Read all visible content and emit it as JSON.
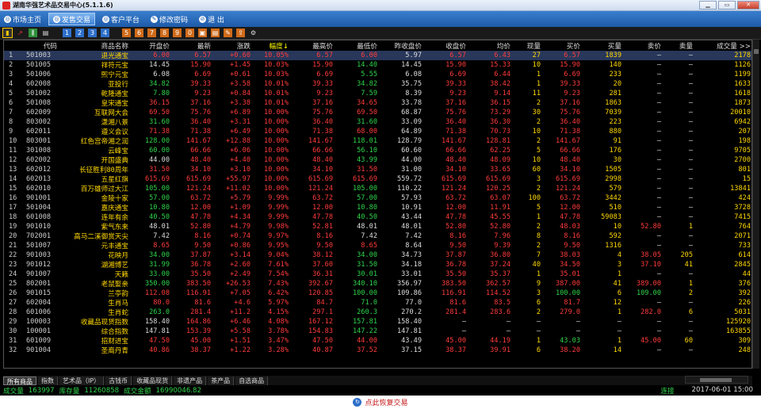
{
  "window": {
    "title": "湖南华强艺术品交易中心(5.1.1.6)"
  },
  "menu": [
    {
      "label": "市场主页",
      "icon": "globe-icon",
      "active": false
    },
    {
      "label": "发售交易",
      "icon": "globe-icon",
      "active": true
    },
    {
      "label": "客户平台",
      "icon": "globe-icon",
      "active": false
    },
    {
      "label": "修改密码",
      "icon": "lock-icon",
      "active": false
    },
    {
      "label": "退   出",
      "icon": "exit-icon",
      "active": false
    }
  ],
  "toolbar_icons": [
    "bar-chart-icon",
    "line-chart-icon",
    "candle-icon",
    "calculator-icon",
    "f1-icon",
    "f2-icon",
    "f3-icon",
    "f4-icon",
    "f5-icon",
    "f6-icon",
    "f7-icon",
    "f8-icon",
    "f9-icon",
    "f10-icon",
    "f11-icon",
    "f12-icon",
    "edit-icon",
    "export-icon",
    "settings-icon"
  ],
  "table": {
    "headers": [
      "",
      "代码",
      "商品名称",
      "开盘价",
      "最新",
      "涨跌",
      "幅度↓",
      "最高价",
      "最低价",
      "昨收盘价",
      "收盘价",
      "均价",
      "现量",
      "买价",
      "买量",
      "卖价",
      "卖量",
      "成交量 >>"
    ],
    "rows": [
      [
        "1",
        "501003",
        "退光通宝",
        "6.00",
        "6.57",
        "+0.60",
        "10.05%",
        "6.57",
        "6.00",
        "5.97",
        "6.57",
        "6.43",
        "27",
        "6.57",
        "1839",
        "—",
        "—",
        "2178"
      ],
      [
        "2",
        "501005",
        "祥符元宝",
        "14.45",
        "15.90",
        "+1.45",
        "10.03%",
        "15.90",
        "14.40",
        "14.45",
        "15.90",
        "15.33",
        "10",
        "15.90",
        "140",
        "—",
        "—",
        "1126"
      ],
      [
        "3",
        "501006",
        "熙宁元宝",
        "6.08",
        "6.69",
        "+0.61",
        "10.03%",
        "6.69",
        "5.55",
        "6.08",
        "6.69",
        "6.44",
        "1",
        "6.69",
        "233",
        "—",
        "—",
        "1199"
      ],
      [
        "4",
        "602008",
        "亚投行",
        "34.82",
        "39.33",
        "+3.58",
        "10.01%",
        "39.33",
        "34.82",
        "35.75",
        "39.33",
        "38.42",
        "1",
        "39.33",
        "20",
        "—",
        "—",
        "1633"
      ],
      [
        "5",
        "501002",
        "乾隆通宝",
        "7.80",
        "9.23",
        "+0.84",
        "10.01%",
        "9.23",
        "7.59",
        "8.39",
        "9.23",
        "9.14",
        "11",
        "9.23",
        "281",
        "—",
        "—",
        "1618"
      ],
      [
        "6",
        "501008",
        "皇宋通宝",
        "36.15",
        "37.16",
        "+3.38",
        "10.01%",
        "37.16",
        "34.65",
        "33.78",
        "37.16",
        "36.15",
        "2",
        "37.16",
        "1863",
        "—",
        "—",
        "1873"
      ],
      [
        "7",
        "602009",
        "互联网大会",
        "69.50",
        "75.76",
        "+6.89",
        "10.00%",
        "75.76",
        "69.50",
        "68.87",
        "75.76",
        "73.29",
        "30",
        "75.76",
        "7039",
        "—",
        "—",
        "20010"
      ],
      [
        "8",
        "803002",
        "潇湘八景",
        "31.60",
        "36.40",
        "+3.31",
        "10.00%",
        "36.40",
        "31.60",
        "33.09",
        "36.40",
        "36.30",
        "2",
        "36.40",
        "223",
        "—",
        "—",
        "6942"
      ],
      [
        "9",
        "602011",
        "遵义会议",
        "71.38",
        "71.38",
        "+6.49",
        "10.00%",
        "71.38",
        "68.00",
        "64.89",
        "71.38",
        "70.73",
        "10",
        "71.38",
        "880",
        "—",
        "—",
        "207"
      ],
      [
        "10",
        "803001",
        "红色宫帝湘之润",
        "128.00",
        "141.67",
        "+12.88",
        "10.00%",
        "141.67",
        "118.01",
        "128.79",
        "141.67",
        "128.81",
        "2",
        "141.67",
        "91",
        "—",
        "—",
        "198"
      ],
      [
        "11",
        "301008",
        "云峰宝",
        "60.00",
        "66.66",
        "+6.06",
        "10.00%",
        "66.66",
        "56.10",
        "60.60",
        "66.66",
        "62.25",
        "5",
        "66.66",
        "176",
        "—",
        "—",
        "9705"
      ],
      [
        "12",
        "602002",
        "开国盛典",
        "44.00",
        "48.40",
        "+4.40",
        "10.00%",
        "48.40",
        "43.99",
        "44.00",
        "48.40",
        "48.09",
        "10",
        "48.40",
        "30",
        "—",
        "—",
        "2700"
      ],
      [
        "13",
        "602012",
        "长征胜利80周年",
        "31.50",
        "34.10",
        "+3.10",
        "10.00%",
        "34.10",
        "31.50",
        "31.00",
        "34.10",
        "33.65",
        "60",
        "34.10",
        "1505",
        "—",
        "—",
        "801"
      ],
      [
        "14",
        "602013",
        "五星红旗",
        "615.69",
        "615.69",
        "+55.97",
        "10.00%",
        "615.69",
        "615.69",
        "559.72",
        "615.69",
        "615.69",
        "3",
        "615.69",
        "2998",
        "—",
        "—",
        "15"
      ],
      [
        "15",
        "602010",
        "百万雄师过大江",
        "105.00",
        "121.24",
        "+11.02",
        "10.00%",
        "121.24",
        "105.00",
        "110.22",
        "121.24",
        "120.25",
        "2",
        "121.24",
        "579",
        "—",
        "—",
        "13841"
      ],
      [
        "16",
        "901001",
        "金陵十家",
        "57.00",
        "63.72",
        "+5.79",
        "9.99%",
        "63.72",
        "57.00",
        "57.93",
        "63.72",
        "63.07",
        "100",
        "63.72",
        "3442",
        "—",
        "—",
        "424"
      ],
      [
        "17",
        "501004",
        "嘉庆通宝",
        "10.80",
        "12.00",
        "+1.09",
        "9.99%",
        "12.00",
        "10.80",
        "10.91",
        "12.00",
        "11.91",
        "5",
        "12.00",
        "510",
        "—",
        "—",
        "3728"
      ],
      [
        "18",
        "601008",
        "连年有余",
        "40.50",
        "47.78",
        "+4.34",
        "9.99%",
        "47.78",
        "40.50",
        "43.44",
        "47.78",
        "45.55",
        "1",
        "47.78",
        "59083",
        "—",
        "—",
        "7415"
      ],
      [
        "19",
        "901010",
        "紫气东来",
        "48.01",
        "52.80",
        "+4.79",
        "9.98%",
        "52.81",
        "48.01",
        "48.01",
        "52.80",
        "52.80",
        "2",
        "48.03",
        "10",
        "52.80",
        "1",
        "764"
      ],
      [
        "20",
        "702001",
        "高马二溪御赏天尖",
        "7.42",
        "8.16",
        "+0.74",
        "9.97%",
        "8.16",
        "7.42",
        "7.42",
        "8.16",
        "7.96",
        "8",
        "8.16",
        "592",
        "—",
        "—",
        "2071"
      ],
      [
        "21",
        "501007",
        "元丰通宝",
        "8.65",
        "9.50",
        "+0.86",
        "9.95%",
        "9.50",
        "8.65",
        "8.64",
        "9.50",
        "9.39",
        "2",
        "9.50",
        "1316",
        "—",
        "—",
        "733"
      ],
      [
        "22",
        "901003",
        "花映月",
        "34.00",
        "37.87",
        "+3.14",
        "9.04%",
        "38.12",
        "34.00",
        "34.73",
        "37.87",
        "36.80",
        "7",
        "38.03",
        "4",
        "38.05",
        "205",
        "614"
      ],
      [
        "23",
        "901012",
        "湖湘博艺",
        "31.99",
        "36.78",
        "+2.60",
        "7.61%",
        "37.60",
        "31.50",
        "34.18",
        "36.78",
        "37.24",
        "40",
        "34.50",
        "3",
        "37.10",
        "41",
        "2845"
      ],
      [
        "24",
        "901007",
        "天籁",
        "33.00",
        "35.50",
        "+2.49",
        "7.54%",
        "36.31",
        "30.01",
        "33.01",
        "35.50",
        "35.37",
        "1",
        "35.01",
        "1",
        "—",
        "—",
        "44"
      ],
      [
        "25",
        "802001",
        "老鼠娶亲",
        "350.00",
        "383.50",
        "+26.53",
        "7.43%",
        "392.67",
        "340.10",
        "356.97",
        "383.50",
        "362.57",
        "9",
        "387.00",
        "41",
        "389.00",
        "1",
        "376"
      ],
      [
        "26",
        "901015",
        "兰亭韵",
        "112.08",
        "116.91",
        "+7.05",
        "6.42%",
        "120.85",
        "100.00",
        "109.86",
        "116.91",
        "114.52",
        "3",
        "100.00",
        "6",
        "109.00",
        "2",
        "392"
      ],
      [
        "27",
        "602004",
        "生肖马",
        "80.0",
        "81.6",
        "+4.6",
        "5.97%",
        "84.7",
        "71.0",
        "77.0",
        "81.6",
        "83.5",
        "6",
        "81.7",
        "12",
        "—",
        "—",
        "226"
      ],
      [
        "28",
        "601006",
        "生肖蛇",
        "263.0",
        "281.4",
        "+11.2",
        "4.15%",
        "297.1",
        "260.3",
        "270.2",
        "281.4",
        "283.6",
        "2",
        "279.0",
        "1",
        "282.0",
        "6",
        "5031"
      ],
      [
        "29",
        "100003",
        "收藏品现货指数",
        "158.40",
        "164.86",
        "+6.46",
        "4.08%",
        "167.12",
        "157.81",
        "158.40",
        "—",
        "—",
        "—",
        "—",
        "—",
        "—",
        "—",
        "125920"
      ],
      [
        "30",
        "100001",
        "综合指数",
        "147.81",
        "153.39",
        "+5.58",
        "3.78%",
        "154.83",
        "147.22",
        "147.81",
        "—",
        "—",
        "—",
        "—",
        "—",
        "—",
        "—",
        "163855"
      ],
      [
        "31",
        "601009",
        "招财进宝",
        "47.50",
        "45.00",
        "+1.51",
        "3.47%",
        "47.50",
        "44.00",
        "43.49",
        "45.00",
        "44.19",
        "1",
        "43.03",
        "1",
        "45.00",
        "60",
        "309"
      ],
      [
        "32",
        "901004",
        "圣裔丹青",
        "40.86",
        "38.37",
        "+1.22",
        "3.28%",
        "40.87",
        "37.52",
        "37.15",
        "38.37",
        "39.91",
        "6",
        "38.20",
        "14",
        "—",
        "—",
        "248"
      ]
    ]
  },
  "bottom_tabs": [
    {
      "label": "所有商品",
      "active": true
    },
    {
      "label": "指数",
      "active": false
    },
    {
      "label": "艺术品（IP）",
      "active": false
    },
    {
      "label": "古钱币",
      "active": false
    },
    {
      "label": "收藏品现货",
      "active": false
    },
    {
      "label": "非遗产品",
      "active": false
    },
    {
      "label": "茶产品",
      "active": false
    },
    {
      "label": "自选商品",
      "active": false
    }
  ],
  "status": {
    "vol_label": "成交量",
    "vol": "163997",
    "stock_label": "库存量",
    "stock": "11260858",
    "amt_label": "成交金额",
    "amt": "16990046.82",
    "conn": "连接",
    "datetime": "2017-06-01 15:00"
  },
  "footer": {
    "label": "点此恢复交易"
  }
}
